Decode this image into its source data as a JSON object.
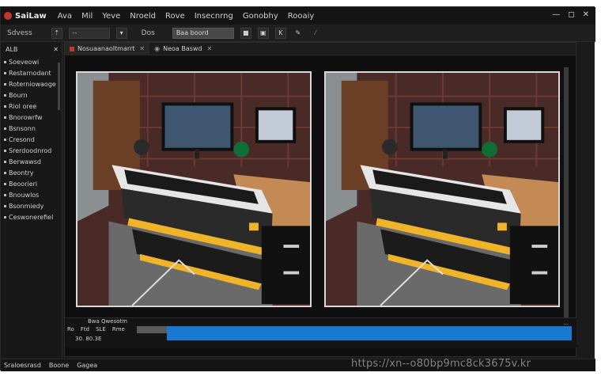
{
  "app": {
    "name": "SaiLaw",
    "menu": [
      "Ava",
      "Mil",
      "Yeve",
      "Nroeld",
      "Rove",
      "Insecnrng",
      "Gonobhy",
      "Rooaiy"
    ],
    "window_controls": [
      "—",
      "◻",
      "✕"
    ]
  },
  "toolbar": {
    "label": "Sdvess",
    "field_value": "--",
    "view_label": "Dos",
    "search_value": "Baa boord"
  },
  "sidebar": {
    "header": "ALB",
    "items": [
      "Soeveowi",
      "Restarnodant",
      "Roterniowaoge",
      "Bourn",
      "Riol oree",
      "Bnorowrfw",
      "Bsnsonn",
      "Cresond",
      "Srerdoodnrod",
      "Berwawsd",
      "Beontry",
      "Beoorieri",
      "Bnouwlos",
      "Bsonmiedy",
      "Ceswonerefiel"
    ]
  },
  "panel": {
    "tabs": [
      {
        "label": "Nosuaanaoltmarrt",
        "active": true
      },
      {
        "label": "Neoa Baswd",
        "active": false
      }
    ]
  },
  "timeline": {
    "label": "Bwa Qwesotm",
    "row_items": [
      "Ro",
      "Ftd",
      "SLE",
      "Rme"
    ],
    "time": "30. 80.3E",
    "marks": "···"
  },
  "statusbar": {
    "items": [
      "Sraloesrasd",
      "Boone",
      "Gagea"
    ]
  },
  "watermark": "https://xn--o80bp9mc8ck3675v.kr",
  "colors": {
    "accent": "#1979d0",
    "logo": "#c0392b",
    "desk_yellow": "#f0b428"
  }
}
